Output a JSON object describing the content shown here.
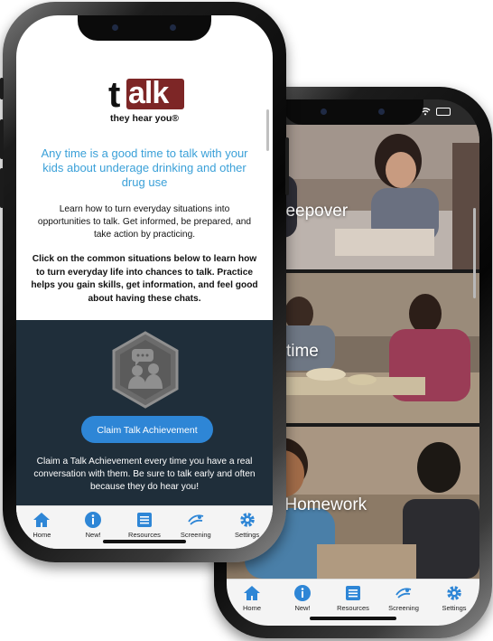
{
  "front": {
    "logo": {
      "letter_t": "t",
      "letters_alk": "alk",
      "tagline": "they hear you®"
    },
    "headline": "Any time is a good time to talk with your kids about underage drinking and other drug use",
    "intro": "Learn how to turn everyday situations into opportunities to talk. Get informed, be prepared, and take action by practicing.",
    "instructions": "Click on the common situations below to learn how to turn everyday life into chances to talk. Practice helps you gain skills, get information, and feel good about having these chats.",
    "claim_button": "Claim Talk Achievement",
    "claim_text": "Claim a Talk Achievement every time you have a real conversation with them. Be sure to talk early and often because they do hear you!"
  },
  "back": {
    "tiles": [
      {
        "label": "e Big Sleepover"
      },
      {
        "label": "Dinnertime"
      },
      {
        "label": "k From Homework"
      }
    ]
  },
  "tabs": [
    {
      "label": "Home",
      "icon": "home-icon"
    },
    {
      "label": "New!",
      "icon": "info-icon"
    },
    {
      "label": "Resources",
      "icon": "list-icon"
    },
    {
      "label": "Screening",
      "icon": "screening-icon"
    },
    {
      "label": "Settings",
      "icon": "gear-icon"
    }
  ],
  "colors": {
    "accent_blue": "#2e86d6",
    "headline_blue": "#3aa0d8",
    "logo_red": "#7d2626",
    "dark_panel": "#1f2e3a"
  }
}
